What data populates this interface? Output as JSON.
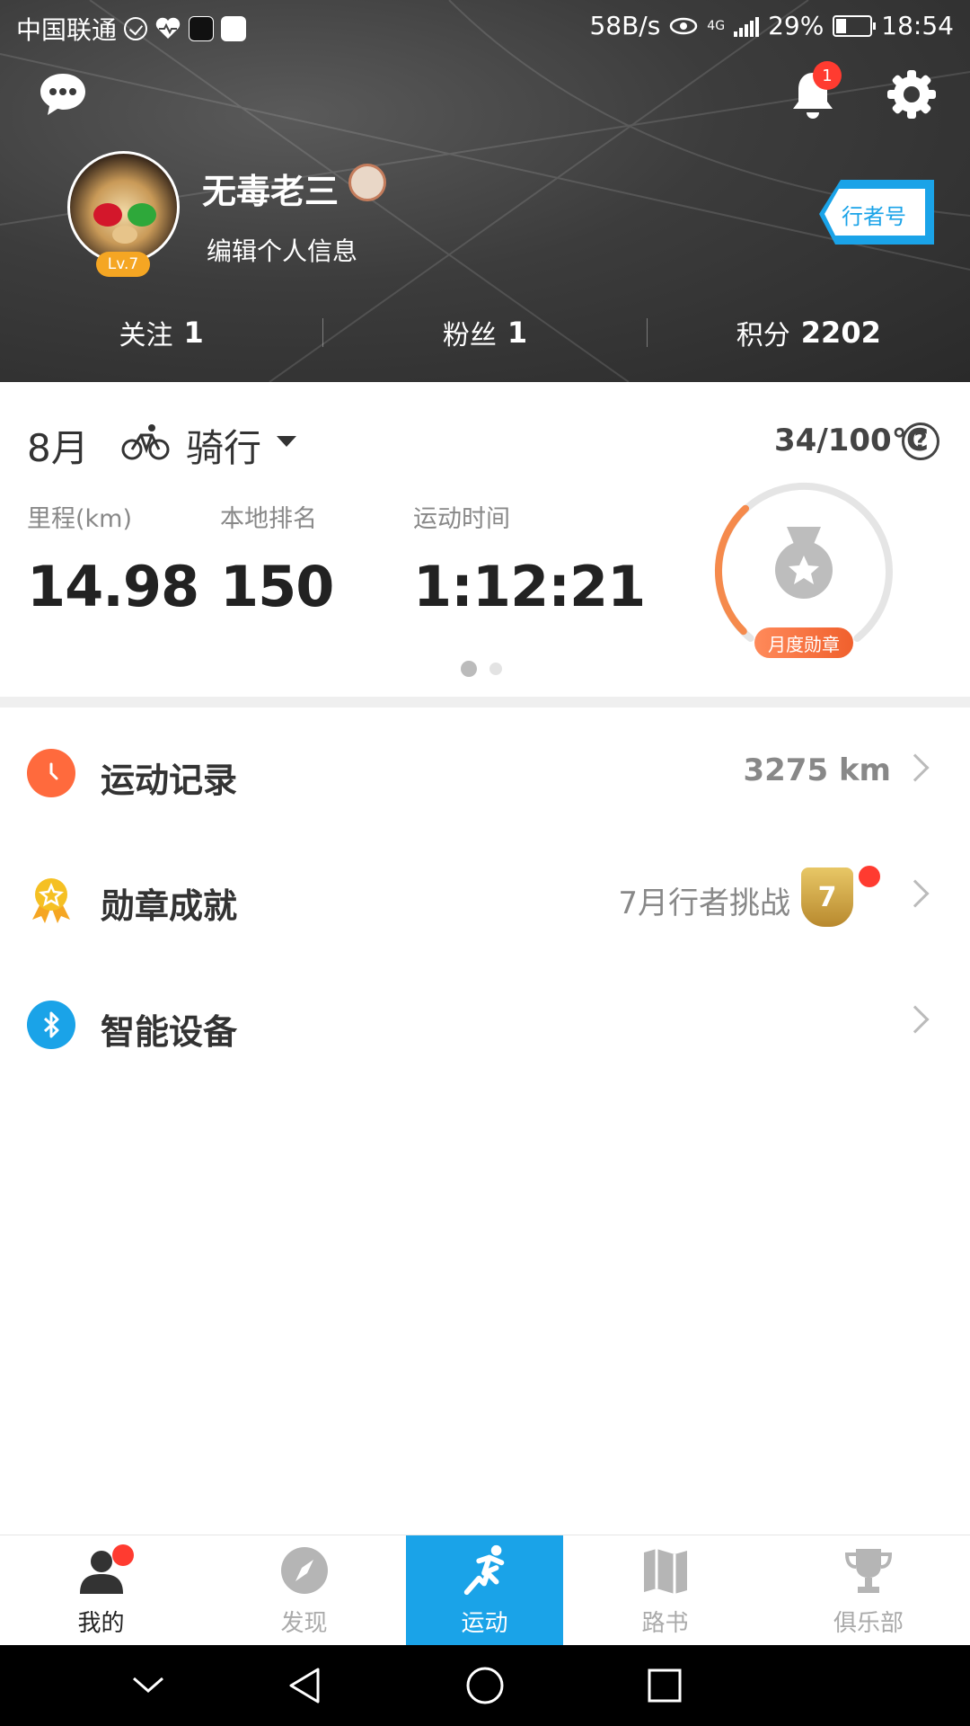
{
  "status_bar": {
    "carrier": "中国联通",
    "net_speed": "58B/s",
    "network_type": "4G",
    "battery": "29%",
    "time": "18:54"
  },
  "header": {
    "notification_count": "1",
    "username": "无毒老三",
    "level": "Lv.7",
    "edit_profile": "编辑个人信息",
    "xingzhe_button": "行者号",
    "stats": [
      {
        "label": "关注",
        "value": "1"
      },
      {
        "label": "粉丝",
        "value": "1"
      },
      {
        "label": "积分",
        "value": "2202"
      }
    ]
  },
  "summary": {
    "month": "8月",
    "activity_type": "骑行",
    "progress": "34/100℃",
    "metrics": [
      {
        "label": "里程(km)",
        "value": "14.98"
      },
      {
        "label": "本地排名",
        "value": "150"
      },
      {
        "label": "运动时间",
        "value": "1:12:21"
      }
    ],
    "medal_label": "月度勋章",
    "medal_progress_fraction": 0.34
  },
  "menu": [
    {
      "label": "运动记录",
      "value": "3275 km",
      "icon": "clock-icon"
    },
    {
      "label": "勋章成就",
      "value": "7月行者挑战",
      "icon": "badge-icon"
    },
    {
      "label": "智能设备",
      "value": "",
      "icon": "bluetooth-icon"
    }
  ],
  "tabs": [
    {
      "label": "我的",
      "icon": "person-icon"
    },
    {
      "label": "发现",
      "icon": "compass-icon"
    },
    {
      "label": "运动",
      "icon": "runner-icon"
    },
    {
      "label": "路书",
      "icon": "map-icon"
    },
    {
      "label": "俱乐部",
      "icon": "trophy-icon"
    }
  ],
  "colors": {
    "accent_blue": "#1aa3e8",
    "accent_orange": "#f0602d",
    "badge_red": "#ff3b30"
  }
}
